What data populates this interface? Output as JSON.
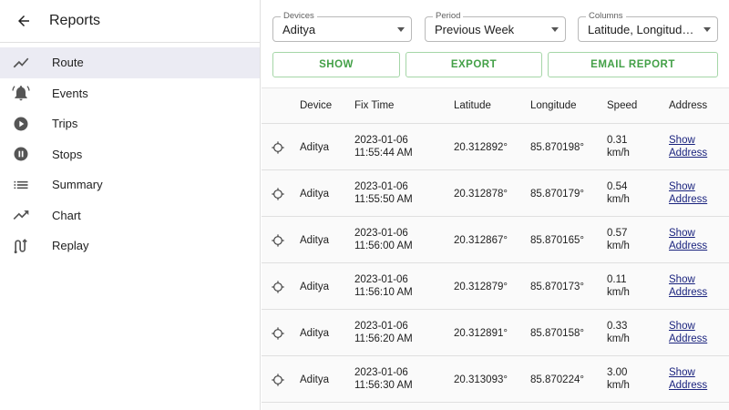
{
  "sidebar": {
    "title": "Reports",
    "items": [
      {
        "label": "Route",
        "icon": "route-icon",
        "active": true
      },
      {
        "label": "Events",
        "icon": "notifications-icon"
      },
      {
        "label": "Trips",
        "icon": "play-icon"
      },
      {
        "label": "Stops",
        "icon": "pause-icon"
      },
      {
        "label": "Summary",
        "icon": "list-icon"
      },
      {
        "label": "Chart",
        "icon": "trending-up-icon"
      },
      {
        "label": "Replay",
        "icon": "replay-route-icon"
      }
    ]
  },
  "filters": {
    "devices": {
      "legend": "Devices",
      "value": "Aditya"
    },
    "period": {
      "legend": "Period",
      "value": "Previous Week"
    },
    "columns": {
      "legend": "Columns",
      "value": "Latitude, Longitude, Speed"
    }
  },
  "buttons": {
    "show": "SHOW",
    "export": "EXPORT",
    "email": "EMAIL REPORT"
  },
  "colors": {
    "accent_green": "#43a047",
    "link": "#1a237e",
    "active_bg": "#ebebf3"
  },
  "table": {
    "headers": [
      "Device",
      "Fix Time",
      "Latitude",
      "Longitude",
      "Speed",
      "Address"
    ],
    "rows": [
      {
        "device": "Aditya",
        "date": "2023-01-06",
        "time": "11:55:44 AM",
        "lat": "20.312892°",
        "lon": "85.870198°",
        "speed_val": "0.31",
        "speed_unit": "km/h",
        "addr1": "Show",
        "addr2": "Address"
      },
      {
        "device": "Aditya",
        "date": "2023-01-06",
        "time": "11:55:50 AM",
        "lat": "20.312878°",
        "lon": "85.870179°",
        "speed_val": "0.54",
        "speed_unit": "km/h",
        "addr1": "Show",
        "addr2": "Address"
      },
      {
        "device": "Aditya",
        "date": "2023-01-06",
        "time": "11:56:00 AM",
        "lat": "20.312867°",
        "lon": "85.870165°",
        "speed_val": "0.57",
        "speed_unit": "km/h",
        "addr1": "Show",
        "addr2": "Address"
      },
      {
        "device": "Aditya",
        "date": "2023-01-06",
        "time": "11:56:10 AM",
        "lat": "20.312879°",
        "lon": "85.870173°",
        "speed_val": "0.11",
        "speed_unit": "km/h",
        "addr1": "Show",
        "addr2": "Address"
      },
      {
        "device": "Aditya",
        "date": "2023-01-06",
        "time": "11:56:20 AM",
        "lat": "20.312891°",
        "lon": "85.870158°",
        "speed_val": "0.33",
        "speed_unit": "km/h",
        "addr1": "Show",
        "addr2": "Address"
      },
      {
        "device": "Aditya",
        "date": "2023-01-06",
        "time": "11:56:30 AM",
        "lat": "20.313093°",
        "lon": "85.870224°",
        "speed_val": "3.00",
        "speed_unit": "km/h",
        "addr1": "Show",
        "addr2": "Address"
      }
    ]
  }
}
